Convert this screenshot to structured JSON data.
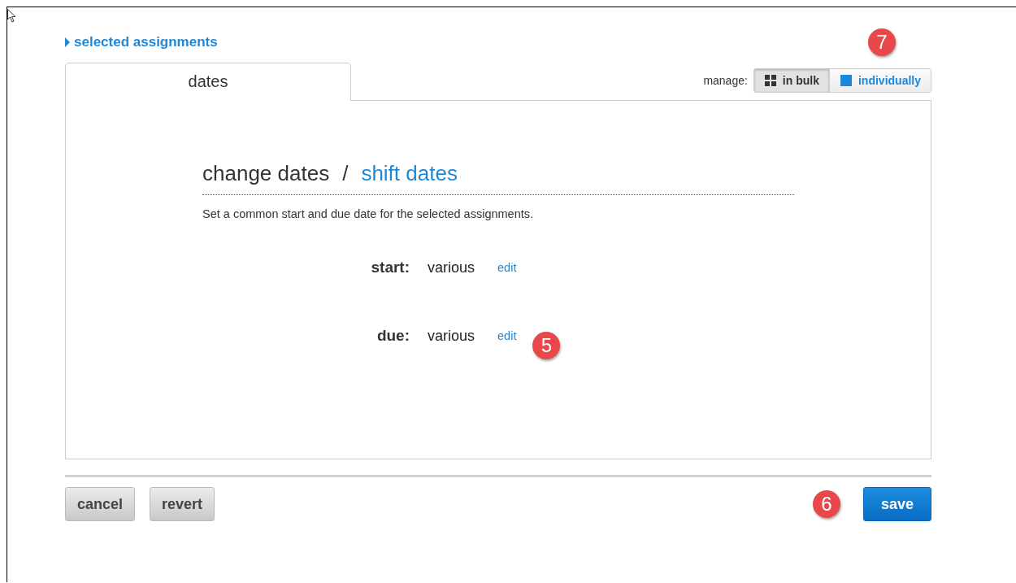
{
  "header": {
    "toggle_label": "selected assignments",
    "expanded": false
  },
  "tabs": [
    {
      "label": "dates",
      "selected": true
    }
  ],
  "manage": {
    "label": "manage:",
    "callout": "7",
    "options": [
      {
        "label": "in bulk",
        "kind": "bulk",
        "selected": true
      },
      {
        "label": "individually",
        "kind": "individual",
        "selected": false
      }
    ]
  },
  "mode_tabs": [
    {
      "label": "change dates",
      "selected": true
    },
    {
      "label": "shift dates",
      "selected": false
    }
  ],
  "separator": "/",
  "description": "Set a common start and due date for the selected assignments.",
  "fields": [
    {
      "label": "start:",
      "value": "various",
      "action": "edit"
    },
    {
      "label": "due:",
      "value": "various",
      "action": "edit",
      "callout": "5"
    }
  ],
  "buttons": [
    {
      "label": "cancel",
      "kind": "secondary"
    },
    {
      "label": "revert",
      "kind": "secondary"
    },
    {
      "label": "save",
      "kind": "primary",
      "callout": "6"
    }
  ]
}
